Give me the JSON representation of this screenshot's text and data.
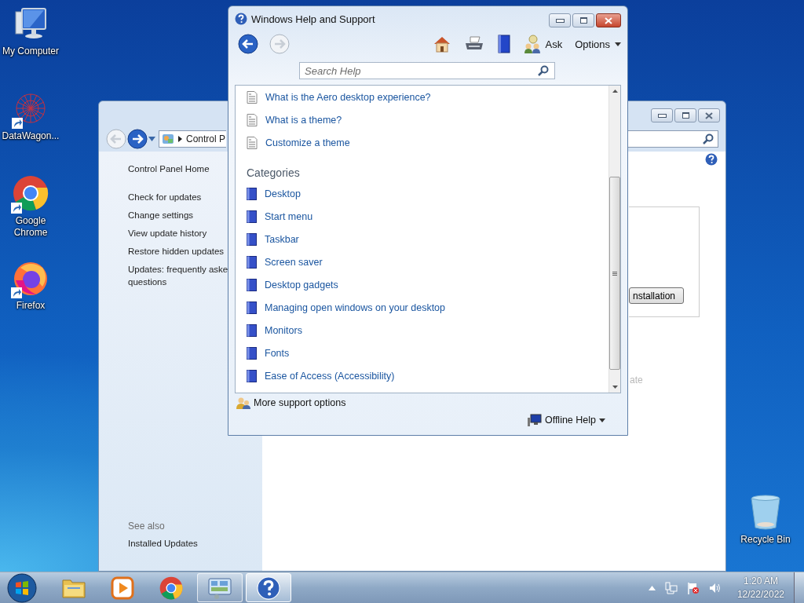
{
  "desktop_icons": [
    {
      "label": "My Computer",
      "kind": "computer",
      "shortcut": false
    },
    {
      "label": "DataWagon...",
      "kind": "datawagon",
      "shortcut": true
    },
    {
      "label": "Google Chrome",
      "kind": "chrome",
      "shortcut": true
    },
    {
      "label": "Firefox",
      "kind": "firefox",
      "shortcut": true
    }
  ],
  "recycle_bin": {
    "label": "Recycle Bin"
  },
  "control_panel": {
    "back_enabled": false,
    "forward_enabled": true,
    "address": "Control P",
    "sidebar_home": "Control Panel Home",
    "links": [
      {
        "lines": [
          "Check for updates"
        ]
      },
      {
        "lines": [
          "Change settings"
        ]
      },
      {
        "lines": [
          "View update history"
        ]
      },
      {
        "lines": [
          "Restore hidden updates"
        ]
      },
      {
        "lines": [
          "Updates: frequently aske",
          "questions"
        ]
      }
    ],
    "see_also_title": "See also",
    "see_also_links": [
      "Installed Updates"
    ],
    "button": "nstallation",
    "faded_text": "ate"
  },
  "help_window": {
    "title": "Windows Help and Support",
    "back_enabled": true,
    "forward_enabled": false,
    "ask": "Ask",
    "options": "Options",
    "search_placeholder": "Search Help",
    "topics": [
      "What is the Aero desktop experience?",
      "What is a theme?",
      "Customize a theme"
    ],
    "categories_heading": "Categories",
    "categories": [
      "Desktop",
      "Start menu",
      "Taskbar",
      "Screen saver",
      "Desktop gadgets",
      "Managing open windows on your desktop",
      "Monitors",
      "Fonts",
      "Ease of Access (Accessibility)"
    ],
    "more_support": "More support options",
    "offline_help": "Offline Help"
  },
  "taskbar": {
    "items": [
      {
        "kind": "explorer",
        "open": false,
        "selected": false
      },
      {
        "kind": "media",
        "open": false,
        "selected": false
      },
      {
        "kind": "chrome",
        "open": false,
        "selected": false
      },
      {
        "kind": "control-panel",
        "open": true,
        "selected": false
      },
      {
        "kind": "help",
        "open": true,
        "selected": true
      }
    ],
    "time": "1:20 AM",
    "date": "12/22/2022"
  }
}
